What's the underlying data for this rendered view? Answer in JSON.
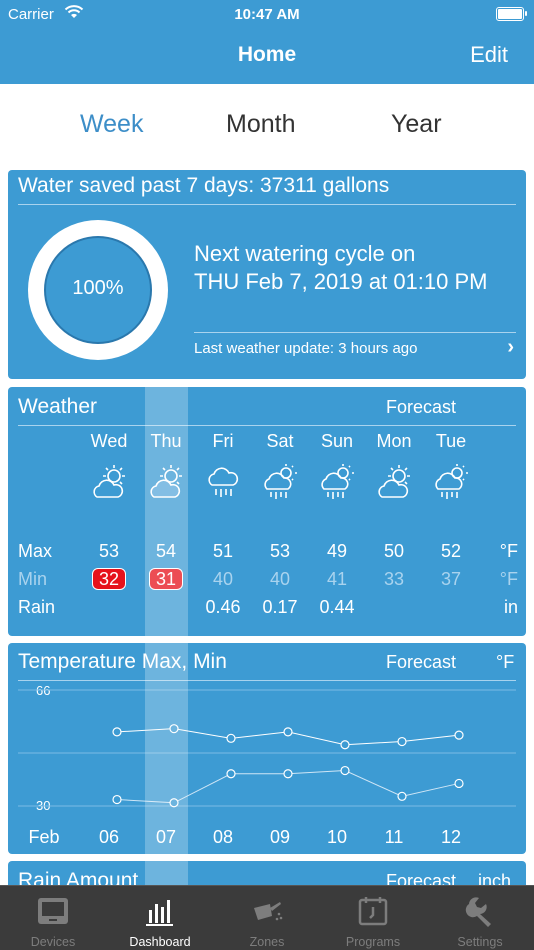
{
  "status_bar": {
    "carrier": "Carrier",
    "time": "10:47 AM"
  },
  "nav": {
    "title": "Home",
    "edit_label": "Edit"
  },
  "periods": [
    {
      "label": "Week",
      "active": true
    },
    {
      "label": "Month",
      "active": false
    },
    {
      "label": "Year",
      "active": false
    }
  ],
  "water": {
    "header": "Water saved past 7 days:  37311 gallons",
    "percent": "100%",
    "next_line1": "Next watering cycle on",
    "next_line2": "THU Feb 7, 2019 at 01:10 PM",
    "last_update": "Last weather update: 3 hours ago"
  },
  "weather": {
    "title": "Weather",
    "forecast_label": "Forecast",
    "row_labels": {
      "max": "Max",
      "min": "Min",
      "rain": "Rain"
    },
    "units": {
      "max": "°F",
      "min": "°F",
      "rain": "in"
    },
    "days": [
      {
        "name": "Wed",
        "icon": "partly-cloudy-icon",
        "max": "53",
        "min": "32",
        "min_alert": true,
        "rain": ""
      },
      {
        "name": "Thu",
        "icon": "partly-cloudy-icon",
        "max": "54",
        "min": "31",
        "min_alert": true,
        "rain": ""
      },
      {
        "name": "Fri",
        "icon": "rain-cloud-icon",
        "max": "51",
        "min": "40",
        "min_alert": false,
        "rain": "0.46"
      },
      {
        "name": "Sat",
        "icon": "sun-showers-icon",
        "max": "53",
        "min": "40",
        "min_alert": false,
        "rain": "0.17"
      },
      {
        "name": "Sun",
        "icon": "sun-showers-icon",
        "max": "49",
        "min": "41",
        "min_alert": false,
        "rain": "0.44"
      },
      {
        "name": "Mon",
        "icon": "partly-cloudy-icon",
        "max": "50",
        "min": "33",
        "min_alert": false,
        "rain": ""
      },
      {
        "name": "Tue",
        "icon": "sun-showers-icon",
        "max": "52",
        "min": "37",
        "min_alert": false,
        "rain": ""
      }
    ]
  },
  "temp_card": {
    "title": "Temperature Max, Min",
    "forecast_label": "Forecast",
    "unit": "°F",
    "month": "Feb"
  },
  "chart_data": {
    "type": "line",
    "categories": [
      "06",
      "07",
      "08",
      "09",
      "10",
      "11",
      "12"
    ],
    "series": [
      {
        "values": [
          53,
          54,
          51,
          53,
          49,
          50,
          52
        ]
      },
      {
        "values": [
          32,
          31,
          40,
          40,
          41,
          33,
          37
        ]
      }
    ],
    "ylim": [
      30,
      66
    ],
    "ytick_labels": [
      "66",
      "30"
    ],
    "xlabel_prefix": "Feb",
    "grid": true
  },
  "rain_card": {
    "title": "Rain Amount",
    "forecast_label": "Forecast",
    "unit": "inch"
  },
  "tabbar": [
    {
      "label": "Devices",
      "icon": "devices-icon",
      "active": false
    },
    {
      "label": "Dashboard",
      "icon": "dashboard-icon",
      "active": true
    },
    {
      "label": "Zones",
      "icon": "watering-can-icon",
      "active": false
    },
    {
      "label": "Programs",
      "icon": "calendar-icon",
      "active": false
    },
    {
      "label": "Settings",
      "icon": "wrench-icon",
      "active": false
    }
  ],
  "colors": {
    "primary": "#3d9bd3",
    "alert": "#e6121b",
    "tabbar": "#3b3b3b"
  }
}
